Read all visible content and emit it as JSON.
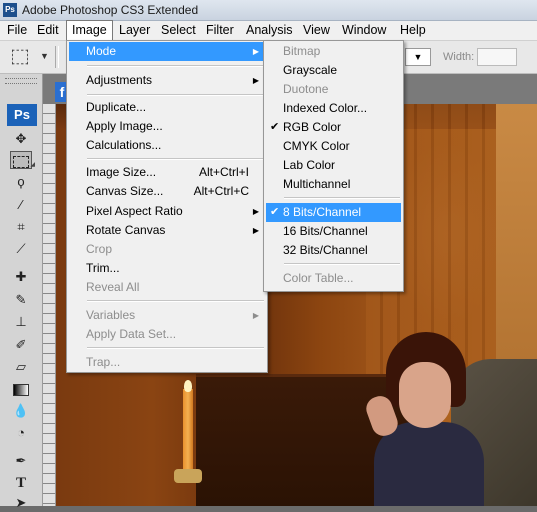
{
  "window": {
    "title": "Adobe Photoshop CS3 Extended",
    "app_badge": "Ps"
  },
  "menubar": [
    "File",
    "Edit",
    "Image",
    "Layer",
    "Select",
    "Filter",
    "Analysis",
    "View",
    "Window",
    "Help"
  ],
  "options": {
    "width_label": "Width:"
  },
  "toolbox": {
    "badge": "Ps"
  },
  "doc_tab": "f",
  "image_menu": {
    "items": [
      {
        "label": "Mode",
        "submenu": true,
        "highlighted": true
      },
      {
        "label": "Adjustments",
        "submenu": true
      },
      {
        "label": "Duplicate..."
      },
      {
        "label": "Apply Image..."
      },
      {
        "label": "Calculations..."
      },
      {
        "label": "Image Size...",
        "shortcut": "Alt+Ctrl+I"
      },
      {
        "label": "Canvas Size...",
        "shortcut": "Alt+Ctrl+C"
      },
      {
        "label": "Pixel Aspect Ratio",
        "submenu": true
      },
      {
        "label": "Rotate Canvas",
        "submenu": true
      },
      {
        "label": "Crop",
        "disabled": true
      },
      {
        "label": "Trim..."
      },
      {
        "label": "Reveal All",
        "disabled": true
      },
      {
        "label": "Variables",
        "submenu": true,
        "disabled": true
      },
      {
        "label": "Apply Data Set...",
        "disabled": true
      },
      {
        "label": "Trap...",
        "disabled": true
      }
    ]
  },
  "mode_menu": {
    "items": [
      {
        "label": "Bitmap",
        "disabled": true
      },
      {
        "label": "Grayscale"
      },
      {
        "label": "Duotone",
        "disabled": true
      },
      {
        "label": "Indexed Color..."
      },
      {
        "label": "RGB Color",
        "checked": true
      },
      {
        "label": "CMYK Color"
      },
      {
        "label": "Lab Color"
      },
      {
        "label": "Multichannel"
      },
      {
        "label": "8 Bits/Channel",
        "checked": true,
        "highlighted": true
      },
      {
        "label": "16 Bits/Channel"
      },
      {
        "label": "32 Bits/Channel"
      },
      {
        "label": "Color Table...",
        "disabled": true
      }
    ]
  },
  "icons": {
    "check": "✔",
    "submenu_arrow": "▶",
    "dropdown_arrow": "▼"
  },
  "colors": {
    "highlight": "#3399ff",
    "disabled_text": "#8d8d8d",
    "ps_blue": "#1b62b8"
  }
}
